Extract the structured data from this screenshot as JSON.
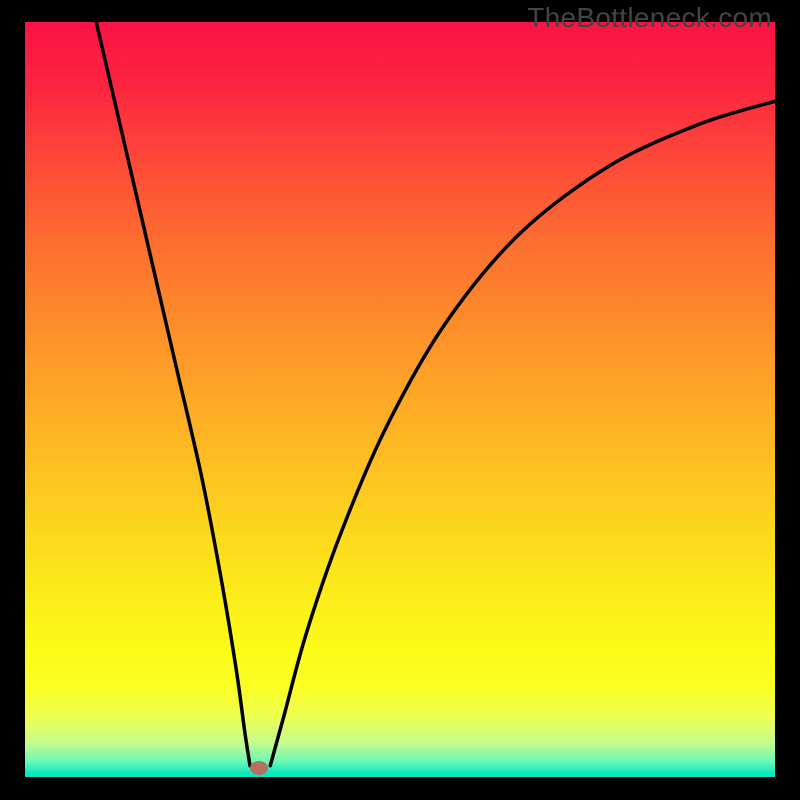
{
  "watermark": "TheBottleneck.com",
  "chart_data": {
    "type": "line",
    "title": "",
    "xlabel": "",
    "ylabel": "",
    "xlim": [
      0,
      1
    ],
    "ylim": [
      0,
      1
    ],
    "gradient_stops": [
      {
        "offset": 0.0,
        "color": "#fb1244"
      },
      {
        "offset": 0.08,
        "color": "#fc2340"
      },
      {
        "offset": 0.18,
        "color": "#fd4838"
      },
      {
        "offset": 0.3,
        "color": "#fd7030"
      },
      {
        "offset": 0.45,
        "color": "#fd9b28"
      },
      {
        "offset": 0.6,
        "color": "#fdc321"
      },
      {
        "offset": 0.73,
        "color": "#fce61b"
      },
      {
        "offset": 0.83,
        "color": "#fbfb17"
      },
      {
        "offset": 0.88,
        "color": "#fafe23"
      },
      {
        "offset": 0.92,
        "color": "#eefe52"
      },
      {
        "offset": 0.955,
        "color": "#c4fd8e"
      },
      {
        "offset": 0.98,
        "color": "#68f7b7"
      },
      {
        "offset": 0.995,
        "color": "#0be9c1"
      },
      {
        "offset": 1.0,
        "color": "#00e5c1"
      }
    ],
    "curve_left": [
      {
        "x": 0.095,
        "y": 1.0
      },
      {
        "x": 0.13,
        "y": 0.85
      },
      {
        "x": 0.165,
        "y": 0.7
      },
      {
        "x": 0.2,
        "y": 0.55
      },
      {
        "x": 0.235,
        "y": 0.4
      },
      {
        "x": 0.262,
        "y": 0.26
      },
      {
        "x": 0.282,
        "y": 0.14
      },
      {
        "x": 0.293,
        "y": 0.06
      },
      {
        "x": 0.3,
        "y": 0.015
      }
    ],
    "curve_right": [
      {
        "x": 0.327,
        "y": 0.015
      },
      {
        "x": 0.345,
        "y": 0.08
      },
      {
        "x": 0.375,
        "y": 0.19
      },
      {
        "x": 0.42,
        "y": 0.32
      },
      {
        "x": 0.48,
        "y": 0.46
      },
      {
        "x": 0.56,
        "y": 0.6
      },
      {
        "x": 0.66,
        "y": 0.72
      },
      {
        "x": 0.78,
        "y": 0.81
      },
      {
        "x": 0.9,
        "y": 0.865
      },
      {
        "x": 1.0,
        "y": 0.895
      }
    ],
    "marker": {
      "x": 0.312,
      "y": 0.012,
      "color": "#b47060"
    }
  }
}
